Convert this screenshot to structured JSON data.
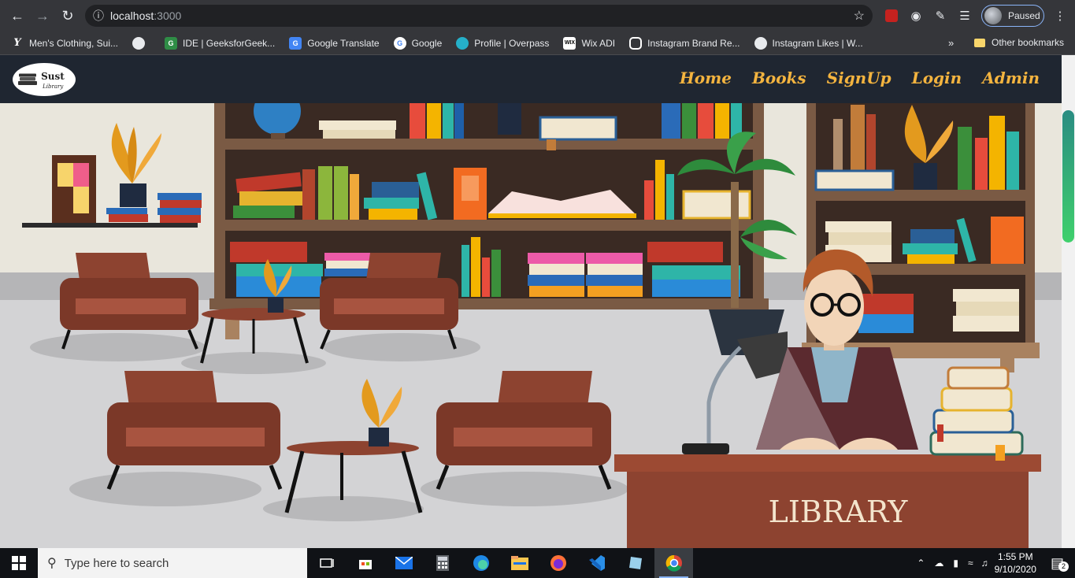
{
  "browser": {
    "url_host": "localhost",
    "url_port": ":3000",
    "profile_label": "Paused",
    "bookmarks": [
      {
        "label": "Men's Clothing, Sui...",
        "icon": "fashion-icon"
      },
      {
        "label": "",
        "icon": "globe-icon"
      },
      {
        "label": "IDE | GeeksforGeek...",
        "icon": "gfg-icon"
      },
      {
        "label": "Google Translate",
        "icon": "translate-icon"
      },
      {
        "label": "Google",
        "icon": "google-icon"
      },
      {
        "label": "Profile | Overpass",
        "icon": "overpass-icon"
      },
      {
        "label": "Wix ADI",
        "icon": "wix-icon"
      },
      {
        "label": "Instagram Brand Re...",
        "icon": "instagram-icon"
      },
      {
        "label": "Instagram Likes | W...",
        "icon": "globe-icon"
      }
    ],
    "more_label": "»",
    "other_bookmarks": "Other bookmarks"
  },
  "site": {
    "logo_name": "Sust",
    "logo_sub": "Library",
    "nav": [
      "Home",
      "Books",
      "SignUp",
      "Login",
      "Admin"
    ],
    "desk_sign": "LIBRARY",
    "accent": "#f4b43f",
    "navbar_bg": "#1f2631"
  },
  "taskbar": {
    "search_placeholder": "Type here to search",
    "time": "1:55 PM",
    "date": "9/10/2020",
    "notifications": "2"
  }
}
